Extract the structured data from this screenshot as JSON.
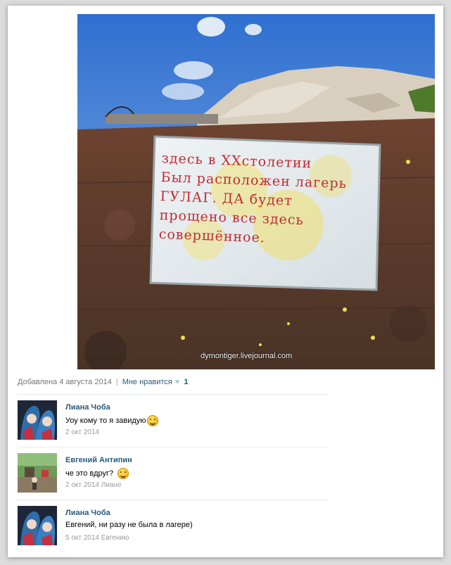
{
  "post": {
    "sign_lines": [
      "здесь в XXстолетии",
      "Был расположен лагерь",
      "ГУЛАГ.   ДА будет",
      "прощено все здесь",
      "совершённое."
    ],
    "watermark": "dymontiger.livejournal.com",
    "added_label": "Добавлена 4 августа 2014",
    "like_label": "Мне нравится",
    "like_count": "1"
  },
  "comments": [
    {
      "author": "Лиана Чоба",
      "text": "Уоу кому то я завидую",
      "emoji": "smiling-face-icon",
      "date": "2 окт 2014"
    },
    {
      "author": "Евгений Антипин",
      "text": "че это вдруг?",
      "emoji": "grinning-face-icon",
      "date": "2 окт 2014 Лиане"
    },
    {
      "author": "Лиана Чоба",
      "text": "Евгений, ни разу не была в лагере)",
      "date": "5 окт 2014 Евгению"
    }
  ],
  "colors": {
    "link": "#2b587a",
    "muted": "#999999",
    "sign_red": "#c42a34",
    "sky": "#4a86d8"
  }
}
